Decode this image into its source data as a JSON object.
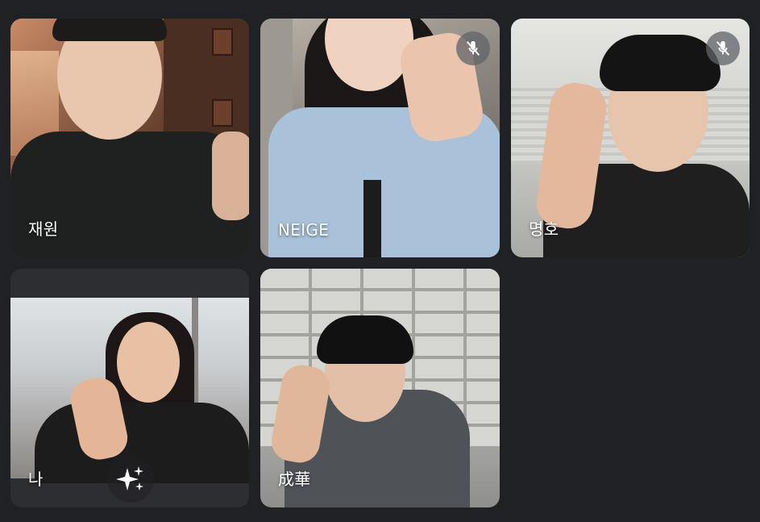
{
  "participants": [
    {
      "name": "재원",
      "muted": false
    },
    {
      "name": "NEIGE",
      "muted": true
    },
    {
      "name": "명호",
      "muted": true
    },
    {
      "name": "나",
      "muted": false,
      "is_self": true
    },
    {
      "name": "成華",
      "muted": false
    }
  ],
  "icons": {
    "mute": "mic-off-icon",
    "effects": "sparkle-icon"
  },
  "colors": {
    "background": "#202124",
    "tile_placeholder": "#3c4043",
    "mute_badge": "#5f6368",
    "name_text": "#ffffff"
  }
}
